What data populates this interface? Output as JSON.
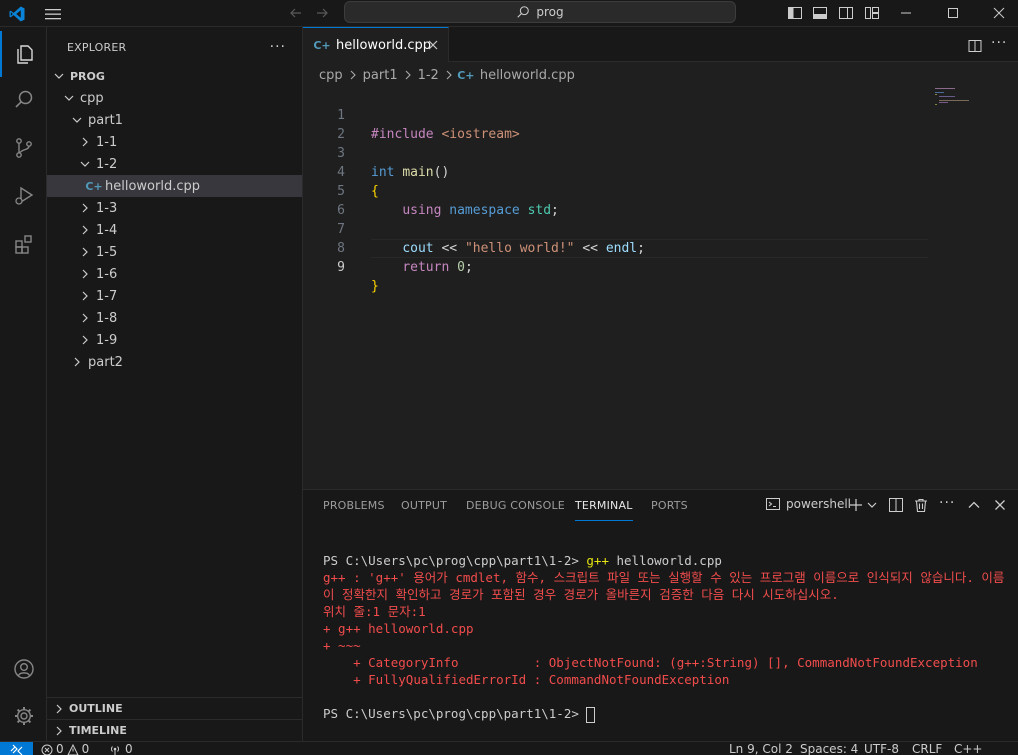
{
  "titlebar": {
    "search_label": "prog"
  },
  "sidebar": {
    "header": "EXPLORER",
    "more": "···",
    "root": "PROG",
    "tree": {
      "cpp": "cpp",
      "part1": "part1",
      "f11": "1-1",
      "f12": "1-2",
      "file": "helloworld.cpp",
      "f13": "1-3",
      "f14": "1-4",
      "f15": "1-5",
      "f16": "1-6",
      "f17": "1-7",
      "f18": "1-8",
      "f19": "1-9",
      "part2": "part2"
    },
    "outline": "OUTLINE",
    "timeline": "TIMELINE"
  },
  "editor": {
    "tab_label": "helloworld.cpp",
    "breadcrumb": [
      "cpp",
      "part1",
      "1-2",
      "helloworld.cpp"
    ],
    "line_numbers": [
      "1",
      "2",
      "3",
      "4",
      "5",
      "6",
      "7",
      "8",
      "9"
    ],
    "code": {
      "l1_include": "#include",
      "l1_header": "<iostream>",
      "l3_int": "int",
      "l3_main": "main",
      "l3_parens": "()",
      "l4_brace": "{",
      "l5_using": "using",
      "l5_namespace": "namespace",
      "l5_std": "std",
      "l5_semi": ";",
      "l7_cout": "cout",
      "l7_op1": " << ",
      "l7_str": "\"hello world!\"",
      "l7_op2": " << ",
      "l7_endl": "endl",
      "l7_semi": ";",
      "l8_return": "return",
      "l8_zero": "0",
      "l8_semi": ";",
      "l9_brace": "}"
    }
  },
  "panel": {
    "tabs": [
      "PROBLEMS",
      "OUTPUT",
      "DEBUG CONSOLE",
      "TERMINAL",
      "PORTS"
    ],
    "shell_label": "powershell",
    "terminal": {
      "prompt1": "PS C:\\Users\\pc\\prog\\cpp\\part1\\1-2> ",
      "cmd1": "g++",
      "cmd1_rest": " helloworld.cpp",
      "err1": "g++ : 'g++' 용어가 cmdlet, 함수, 스크립트 파일 또는 실행할 수 있는 프로그램 이름으로 인식되지 않습니다. 이름이 정확한지 확인하고 경로가 포함된 경우 경로가 올바른지 검증한 다음 다시 시도하십시오.",
      "err2": "위치 줄:1 문자:1",
      "err3": "+ g++ helloworld.cpp",
      "err4": "+ ~~~",
      "err5": "    + CategoryInfo          : ObjectNotFound: (g++:String) [], CommandNotFoundException",
      "err6": "    + FullyQualifiedErrorId : CommandNotFoundException",
      "prompt2": "PS C:\\Users\\pc\\prog\\cpp\\part1\\1-2> "
    }
  },
  "statusbar": {
    "errors": "0",
    "warnings": "0",
    "ports": "0",
    "position": "Ln 9, Col 2",
    "spaces": "Spaces: 4",
    "encoding": "UTF-8",
    "eol": "CRLF",
    "language": "C++"
  }
}
